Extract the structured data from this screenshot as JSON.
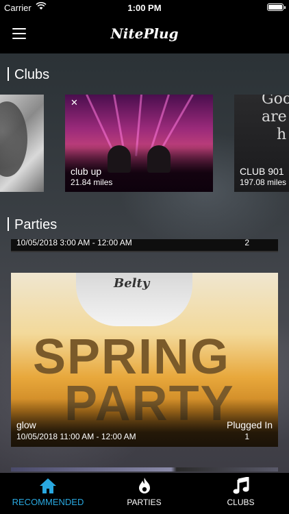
{
  "status_bar": {
    "carrier": "Carrier",
    "time": "1:00 PM"
  },
  "nav": {
    "title": "NitePlug"
  },
  "clubs": {
    "heading": "Clubs",
    "items": [
      {
        "name": "club up",
        "distance": "21.84 miles"
      },
      {
        "name": "CLUB 901",
        "distance": "197.08 miles"
      }
    ],
    "partial_card_text": [
      "Goo",
      "are",
      "h"
    ]
  },
  "parties": {
    "heading": "Parties",
    "items": [
      {
        "date": "10/05/2018 3:00 AM - 12:00 AM",
        "count": "2"
      },
      {
        "name": "glow",
        "date": "10/05/2018 11:00 AM - 12:00 AM",
        "plugged_label": "Plugged In",
        "count": "1",
        "poster_text": {
          "belt": "Belty",
          "line1": "SPRING",
          "line2": "PARTY"
        }
      }
    ]
  },
  "tabs": [
    {
      "label": "RECOMMENDED",
      "icon": "home-icon",
      "active": true
    },
    {
      "label": "PARTIES",
      "icon": "flame-icon",
      "active": false
    },
    {
      "label": "CLUBS",
      "icon": "music-note-icon",
      "active": false
    }
  ],
  "colors": {
    "accent": "#29a8e0",
    "bar_bg": "#000000"
  }
}
